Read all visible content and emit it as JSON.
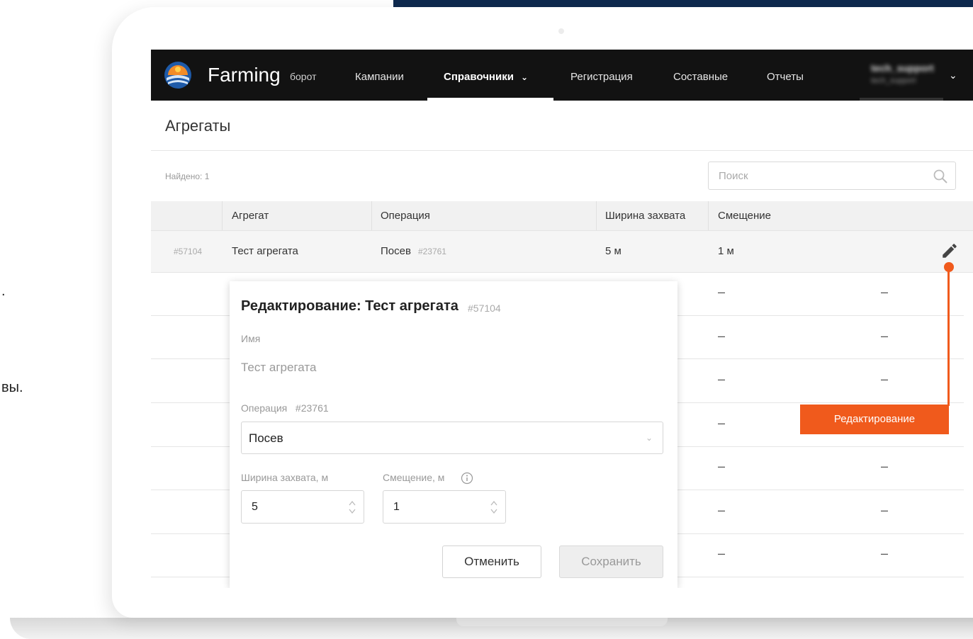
{
  "side_text": {
    "line1": ".",
    "line2": "вы."
  },
  "navbar": {
    "brand": "Farming",
    "brand_sub": "борот",
    "items": [
      {
        "label": "Кампании"
      },
      {
        "label": "Справочники"
      },
      {
        "label": "Регистрация"
      },
      {
        "label": "Составные"
      },
      {
        "label": "Отчеты"
      }
    ],
    "user": {
      "name": "tech_support",
      "sub": "tech_support"
    }
  },
  "page": {
    "title": "Агрегаты",
    "found": "Найдено: 1",
    "search_placeholder": "Поиск"
  },
  "table": {
    "columns": [
      "Агрегат",
      "Операция",
      "Ширина захвата",
      "Смещение"
    ],
    "rows": [
      {
        "id": "#57104",
        "name": "Тест агрегата",
        "operation": "Посев",
        "operation_id": "#23761",
        "width": "5 м",
        "offset": "1 м"
      }
    ],
    "placeholder_dash": "–"
  },
  "modal": {
    "title": "Редактирование: Тест агрегата",
    "title_id": "#57104",
    "name_label": "Имя",
    "name_value": "Тест агрегата",
    "operation_label": "Операция",
    "operation_id": "#23761",
    "operation_value": "Посев",
    "width_label": "Ширина захвата, м",
    "width_value": "5",
    "offset_label": "Смещение, м",
    "offset_value": "1",
    "cancel_label": "Отменить",
    "save_label": "Сохранить"
  },
  "callout": {
    "label": "Редактирование"
  },
  "colors": {
    "navbar_bg": "#121212",
    "accent_callout": "#f05a1c",
    "top_band": "#0f2a4f"
  }
}
